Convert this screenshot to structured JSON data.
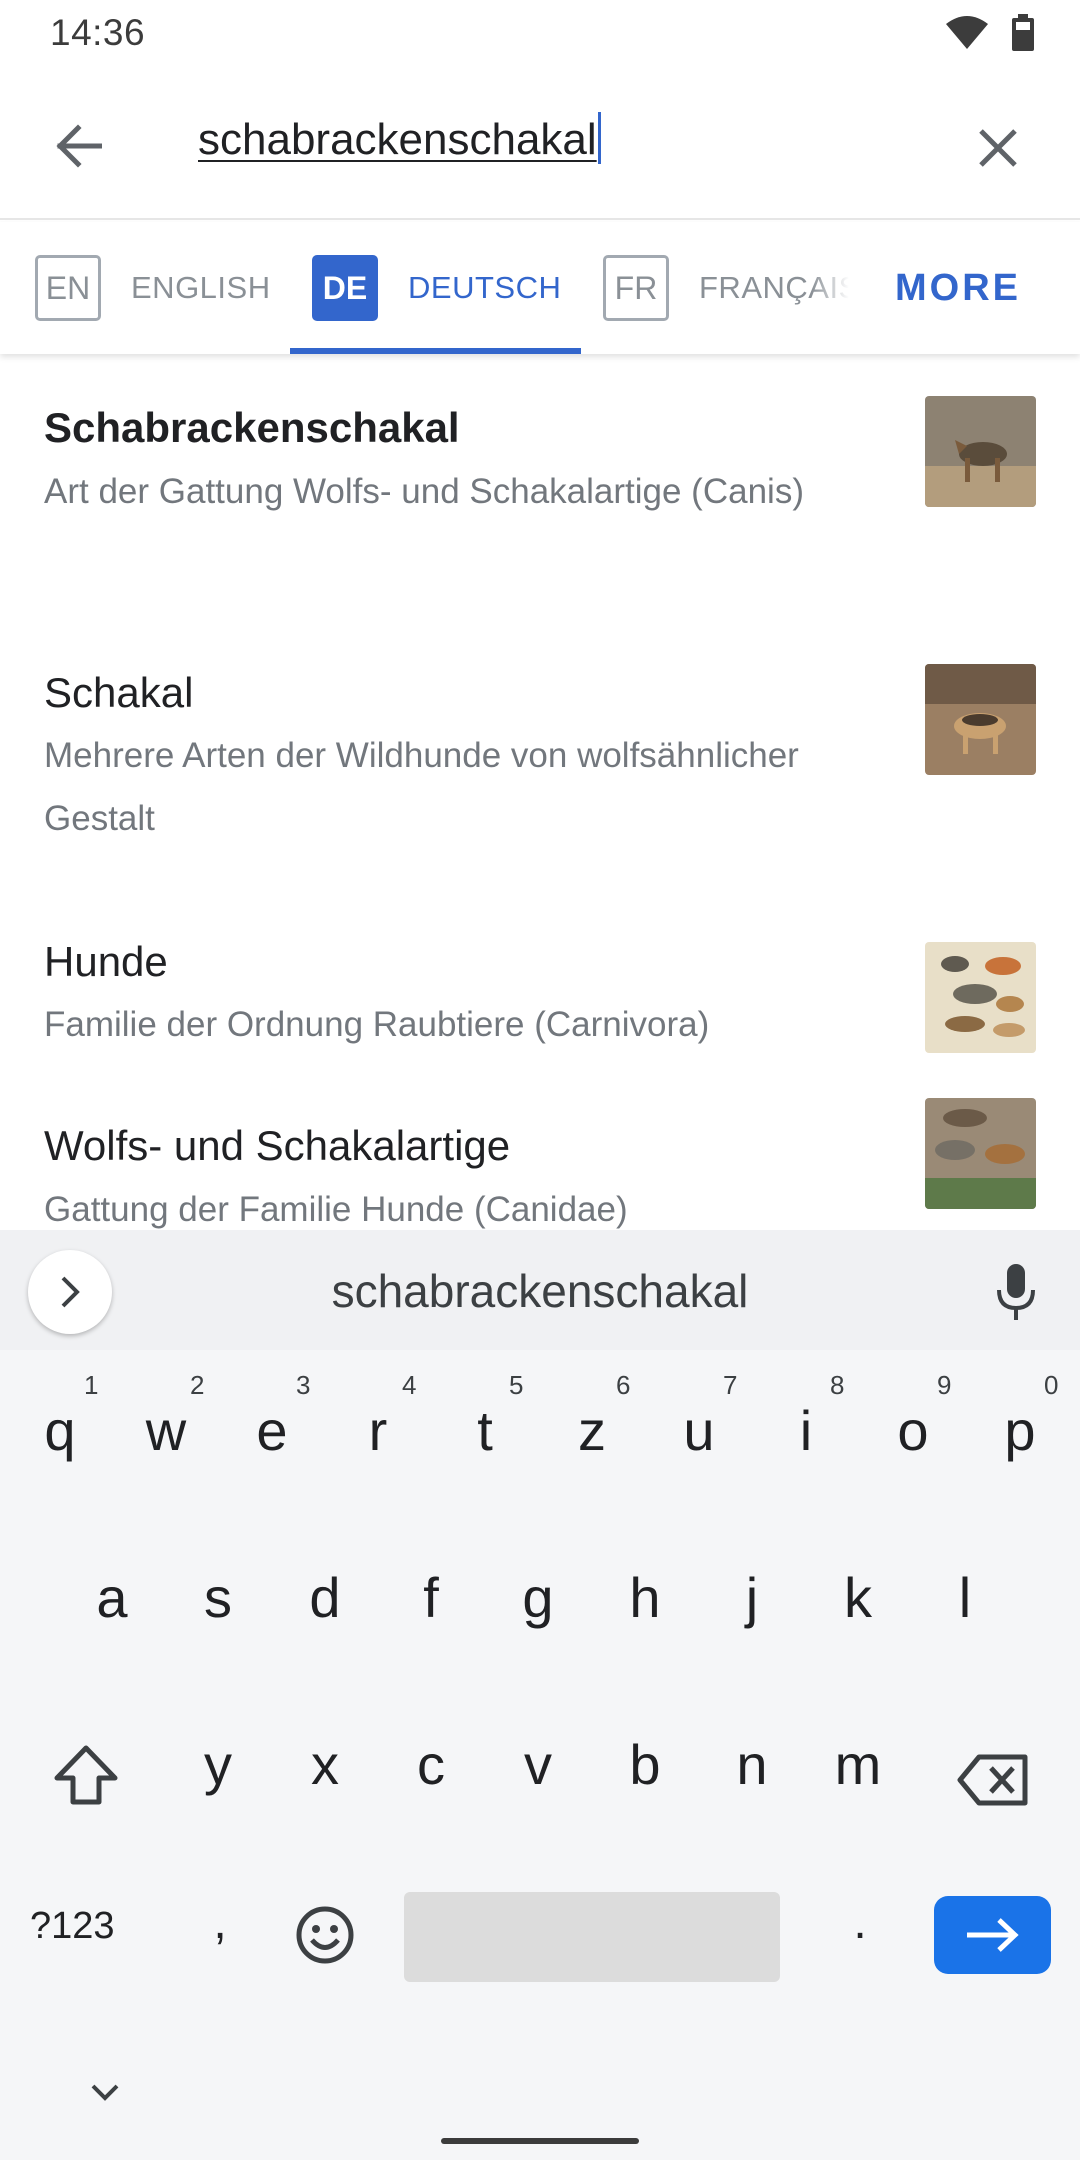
{
  "status_bar": {
    "time": "14:36"
  },
  "search": {
    "query": "schabrackenschakal"
  },
  "language_tabs": [
    {
      "code": "EN",
      "name": "ENGLISH",
      "active": false
    },
    {
      "code": "DE",
      "name": "DEUTSCH",
      "active": true
    },
    {
      "code": "FR",
      "name": "FRANÇAIS",
      "active": false
    }
  ],
  "more_label": "MORE",
  "results": [
    {
      "title": "Schabrackenschakal",
      "description": "Art der Gattung Wolfs- und Schakalartige (Canis)"
    },
    {
      "title": "Schakal",
      "description": "Mehrere Arten der Wildhunde von wolfsähnlicher Gestalt"
    },
    {
      "title": "Hunde",
      "description": "Familie der Ordnung Raubtiere (Carnivora)"
    },
    {
      "title": "Wolfs- und Schakalartige",
      "description": "Gattung der Familie Hunde (Canidae)"
    }
  ],
  "keyboard": {
    "suggestion": "schabrackenschakal",
    "row1": [
      "q",
      "w",
      "e",
      "r",
      "t",
      "z",
      "u",
      "i",
      "o",
      "p"
    ],
    "row1_hints": [
      "1",
      "2",
      "3",
      "4",
      "5",
      "6",
      "7",
      "8",
      "9",
      "0"
    ],
    "row2": [
      "a",
      "s",
      "d",
      "f",
      "g",
      "h",
      "j",
      "k",
      "l"
    ],
    "row3": [
      "y",
      "x",
      "c",
      "v",
      "b",
      "n",
      "m"
    ],
    "symbols_label": "?123",
    "comma": ",",
    "period": "."
  },
  "colors": {
    "accent": "#3366cc",
    "enter_key": "#1a73e8",
    "secondary_text": "#72777d"
  }
}
